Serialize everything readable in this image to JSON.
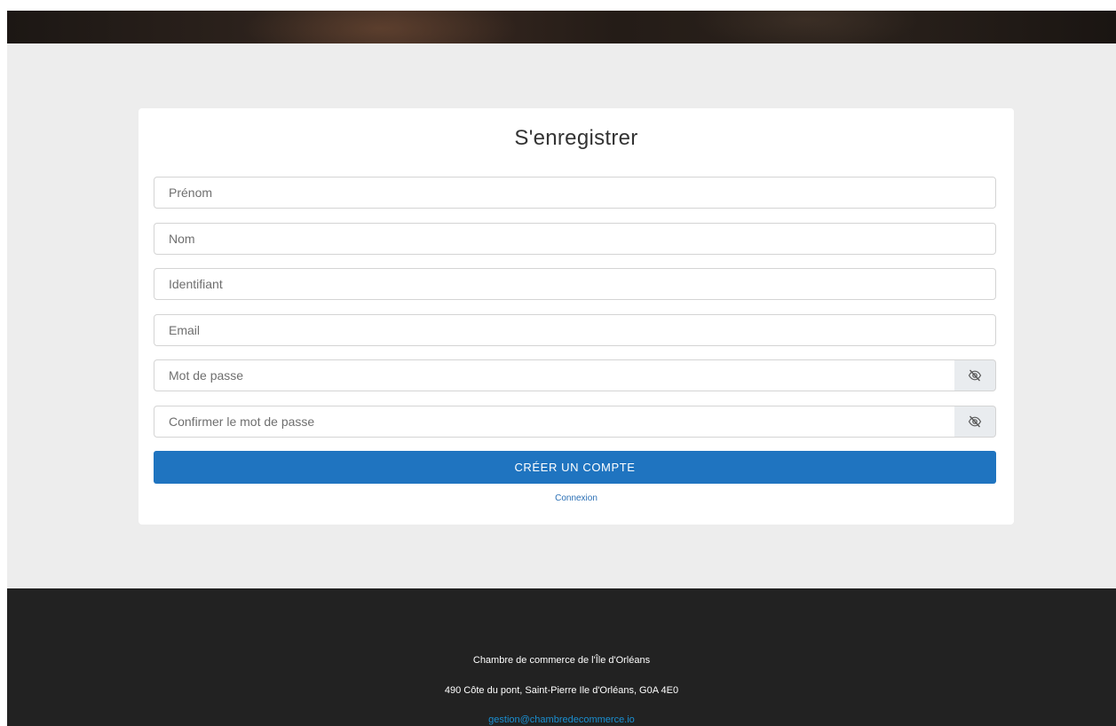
{
  "form": {
    "title": "S'enregistrer",
    "fields": [
      {
        "placeholder": "Prénom",
        "value": ""
      },
      {
        "placeholder": "Nom",
        "value": ""
      },
      {
        "placeholder": "Identifiant",
        "value": ""
      },
      {
        "placeholder": "Email",
        "value": ""
      },
      {
        "placeholder": "Mot de passe",
        "value": "",
        "toggle_icon": "eye-slash-icon"
      },
      {
        "placeholder": "Confirmer le mot de passe",
        "value": "",
        "toggle_icon": "eye-slash-icon"
      }
    ],
    "submit_label": "CRÉER UN COMPTE",
    "login_link": "Connexion"
  },
  "footer": {
    "organization": "Chambre de commerce de l'Île d'Orléans",
    "address": "490 Côte du pont, Saint-Pierre Ile d'Orléans, G0A 4E0",
    "email": "gestion@chambredecommerce.io"
  },
  "colors": {
    "background": "#ededed",
    "primary": "#1f74c0",
    "footer_bg": "#222222",
    "link": "#1a8fd1"
  }
}
